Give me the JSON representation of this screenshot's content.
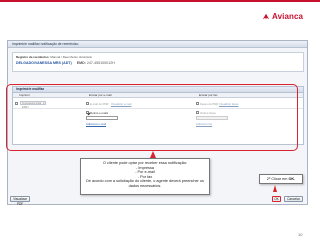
{
  "brand": {
    "logo_text": "Avianca",
    "color": "#c8102e"
  },
  "window": {
    "title": "Imprimir/e mail/fax notificação de reembolso"
  },
  "info": {
    "line1_label": "Registro de reembolso:",
    "line1_value": "Manual / Reembolso Voluntário",
    "passenger_name": "DELGADO/VANESSA MRS (ADT)",
    "emd_label": "EMD:",
    "emd_value": "247-455100012H"
  },
  "section": {
    "header": "Imprimir/e mail/fax",
    "columns": {
      "print": "Imprimir",
      "email": "Enviar por e-mail",
      "fax": "Enviar por fax"
    },
    "row1": {
      "printer_dropdown": "Impressora local EPET",
      "email_text": "E-mail do PNR",
      "email_link": "Visualizar e-mail",
      "fax_text": "Faxes do PNR",
      "fax_link": "Visualizar faxes"
    },
    "row2": {
      "email_other_label": "Outros e-mails",
      "email_add_link": "Adicionar e-mail",
      "fax_other_label": "Outros faxes",
      "fax_add_link": "Adicionar fax"
    }
  },
  "callout": {
    "line1": "O cliente pode optar por receber essa notificação:",
    "line2": "- Impressa",
    "line3": "- Por e-mail",
    "line4": "- Por fax",
    "line5": "De acordo com a solicitação do cliente, o agente deverá preencher os",
    "line6": "dados necessários."
  },
  "click_note": {
    "text_prefix": "2º Clicar em ",
    "text_bold": "OK."
  },
  "buttons": {
    "view_pdf": "Visualizar PDF",
    "ok": "OK",
    "cancel": "Cancelar"
  },
  "page_number": "10",
  "highlight_color": "#d9232f"
}
